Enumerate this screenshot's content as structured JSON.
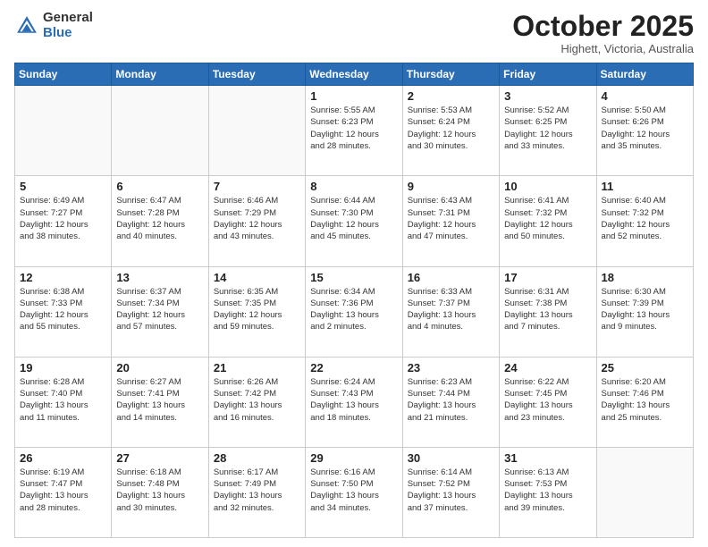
{
  "header": {
    "logo_general": "General",
    "logo_blue": "Blue",
    "month_title": "October 2025",
    "location": "Highett, Victoria, Australia"
  },
  "weekdays": [
    "Sunday",
    "Monday",
    "Tuesday",
    "Wednesday",
    "Thursday",
    "Friday",
    "Saturday"
  ],
  "weeks": [
    [
      {
        "day": "",
        "info": ""
      },
      {
        "day": "",
        "info": ""
      },
      {
        "day": "",
        "info": ""
      },
      {
        "day": "1",
        "info": "Sunrise: 5:55 AM\nSunset: 6:23 PM\nDaylight: 12 hours\nand 28 minutes."
      },
      {
        "day": "2",
        "info": "Sunrise: 5:53 AM\nSunset: 6:24 PM\nDaylight: 12 hours\nand 30 minutes."
      },
      {
        "day": "3",
        "info": "Sunrise: 5:52 AM\nSunset: 6:25 PM\nDaylight: 12 hours\nand 33 minutes."
      },
      {
        "day": "4",
        "info": "Sunrise: 5:50 AM\nSunset: 6:26 PM\nDaylight: 12 hours\nand 35 minutes."
      }
    ],
    [
      {
        "day": "5",
        "info": "Sunrise: 6:49 AM\nSunset: 7:27 PM\nDaylight: 12 hours\nand 38 minutes."
      },
      {
        "day": "6",
        "info": "Sunrise: 6:47 AM\nSunset: 7:28 PM\nDaylight: 12 hours\nand 40 minutes."
      },
      {
        "day": "7",
        "info": "Sunrise: 6:46 AM\nSunset: 7:29 PM\nDaylight: 12 hours\nand 43 minutes."
      },
      {
        "day": "8",
        "info": "Sunrise: 6:44 AM\nSunset: 7:30 PM\nDaylight: 12 hours\nand 45 minutes."
      },
      {
        "day": "9",
        "info": "Sunrise: 6:43 AM\nSunset: 7:31 PM\nDaylight: 12 hours\nand 47 minutes."
      },
      {
        "day": "10",
        "info": "Sunrise: 6:41 AM\nSunset: 7:32 PM\nDaylight: 12 hours\nand 50 minutes."
      },
      {
        "day": "11",
        "info": "Sunrise: 6:40 AM\nSunset: 7:32 PM\nDaylight: 12 hours\nand 52 minutes."
      }
    ],
    [
      {
        "day": "12",
        "info": "Sunrise: 6:38 AM\nSunset: 7:33 PM\nDaylight: 12 hours\nand 55 minutes."
      },
      {
        "day": "13",
        "info": "Sunrise: 6:37 AM\nSunset: 7:34 PM\nDaylight: 12 hours\nand 57 minutes."
      },
      {
        "day": "14",
        "info": "Sunrise: 6:35 AM\nSunset: 7:35 PM\nDaylight: 12 hours\nand 59 minutes."
      },
      {
        "day": "15",
        "info": "Sunrise: 6:34 AM\nSunset: 7:36 PM\nDaylight: 13 hours\nand 2 minutes."
      },
      {
        "day": "16",
        "info": "Sunrise: 6:33 AM\nSunset: 7:37 PM\nDaylight: 13 hours\nand 4 minutes."
      },
      {
        "day": "17",
        "info": "Sunrise: 6:31 AM\nSunset: 7:38 PM\nDaylight: 13 hours\nand 7 minutes."
      },
      {
        "day": "18",
        "info": "Sunrise: 6:30 AM\nSunset: 7:39 PM\nDaylight: 13 hours\nand 9 minutes."
      }
    ],
    [
      {
        "day": "19",
        "info": "Sunrise: 6:28 AM\nSunset: 7:40 PM\nDaylight: 13 hours\nand 11 minutes."
      },
      {
        "day": "20",
        "info": "Sunrise: 6:27 AM\nSunset: 7:41 PM\nDaylight: 13 hours\nand 14 minutes."
      },
      {
        "day": "21",
        "info": "Sunrise: 6:26 AM\nSunset: 7:42 PM\nDaylight: 13 hours\nand 16 minutes."
      },
      {
        "day": "22",
        "info": "Sunrise: 6:24 AM\nSunset: 7:43 PM\nDaylight: 13 hours\nand 18 minutes."
      },
      {
        "day": "23",
        "info": "Sunrise: 6:23 AM\nSunset: 7:44 PM\nDaylight: 13 hours\nand 21 minutes."
      },
      {
        "day": "24",
        "info": "Sunrise: 6:22 AM\nSunset: 7:45 PM\nDaylight: 13 hours\nand 23 minutes."
      },
      {
        "day": "25",
        "info": "Sunrise: 6:20 AM\nSunset: 7:46 PM\nDaylight: 13 hours\nand 25 minutes."
      }
    ],
    [
      {
        "day": "26",
        "info": "Sunrise: 6:19 AM\nSunset: 7:47 PM\nDaylight: 13 hours\nand 28 minutes."
      },
      {
        "day": "27",
        "info": "Sunrise: 6:18 AM\nSunset: 7:48 PM\nDaylight: 13 hours\nand 30 minutes."
      },
      {
        "day": "28",
        "info": "Sunrise: 6:17 AM\nSunset: 7:49 PM\nDaylight: 13 hours\nand 32 minutes."
      },
      {
        "day": "29",
        "info": "Sunrise: 6:16 AM\nSunset: 7:50 PM\nDaylight: 13 hours\nand 34 minutes."
      },
      {
        "day": "30",
        "info": "Sunrise: 6:14 AM\nSunset: 7:52 PM\nDaylight: 13 hours\nand 37 minutes."
      },
      {
        "day": "31",
        "info": "Sunrise: 6:13 AM\nSunset: 7:53 PM\nDaylight: 13 hours\nand 39 minutes."
      },
      {
        "day": "",
        "info": ""
      }
    ]
  ]
}
